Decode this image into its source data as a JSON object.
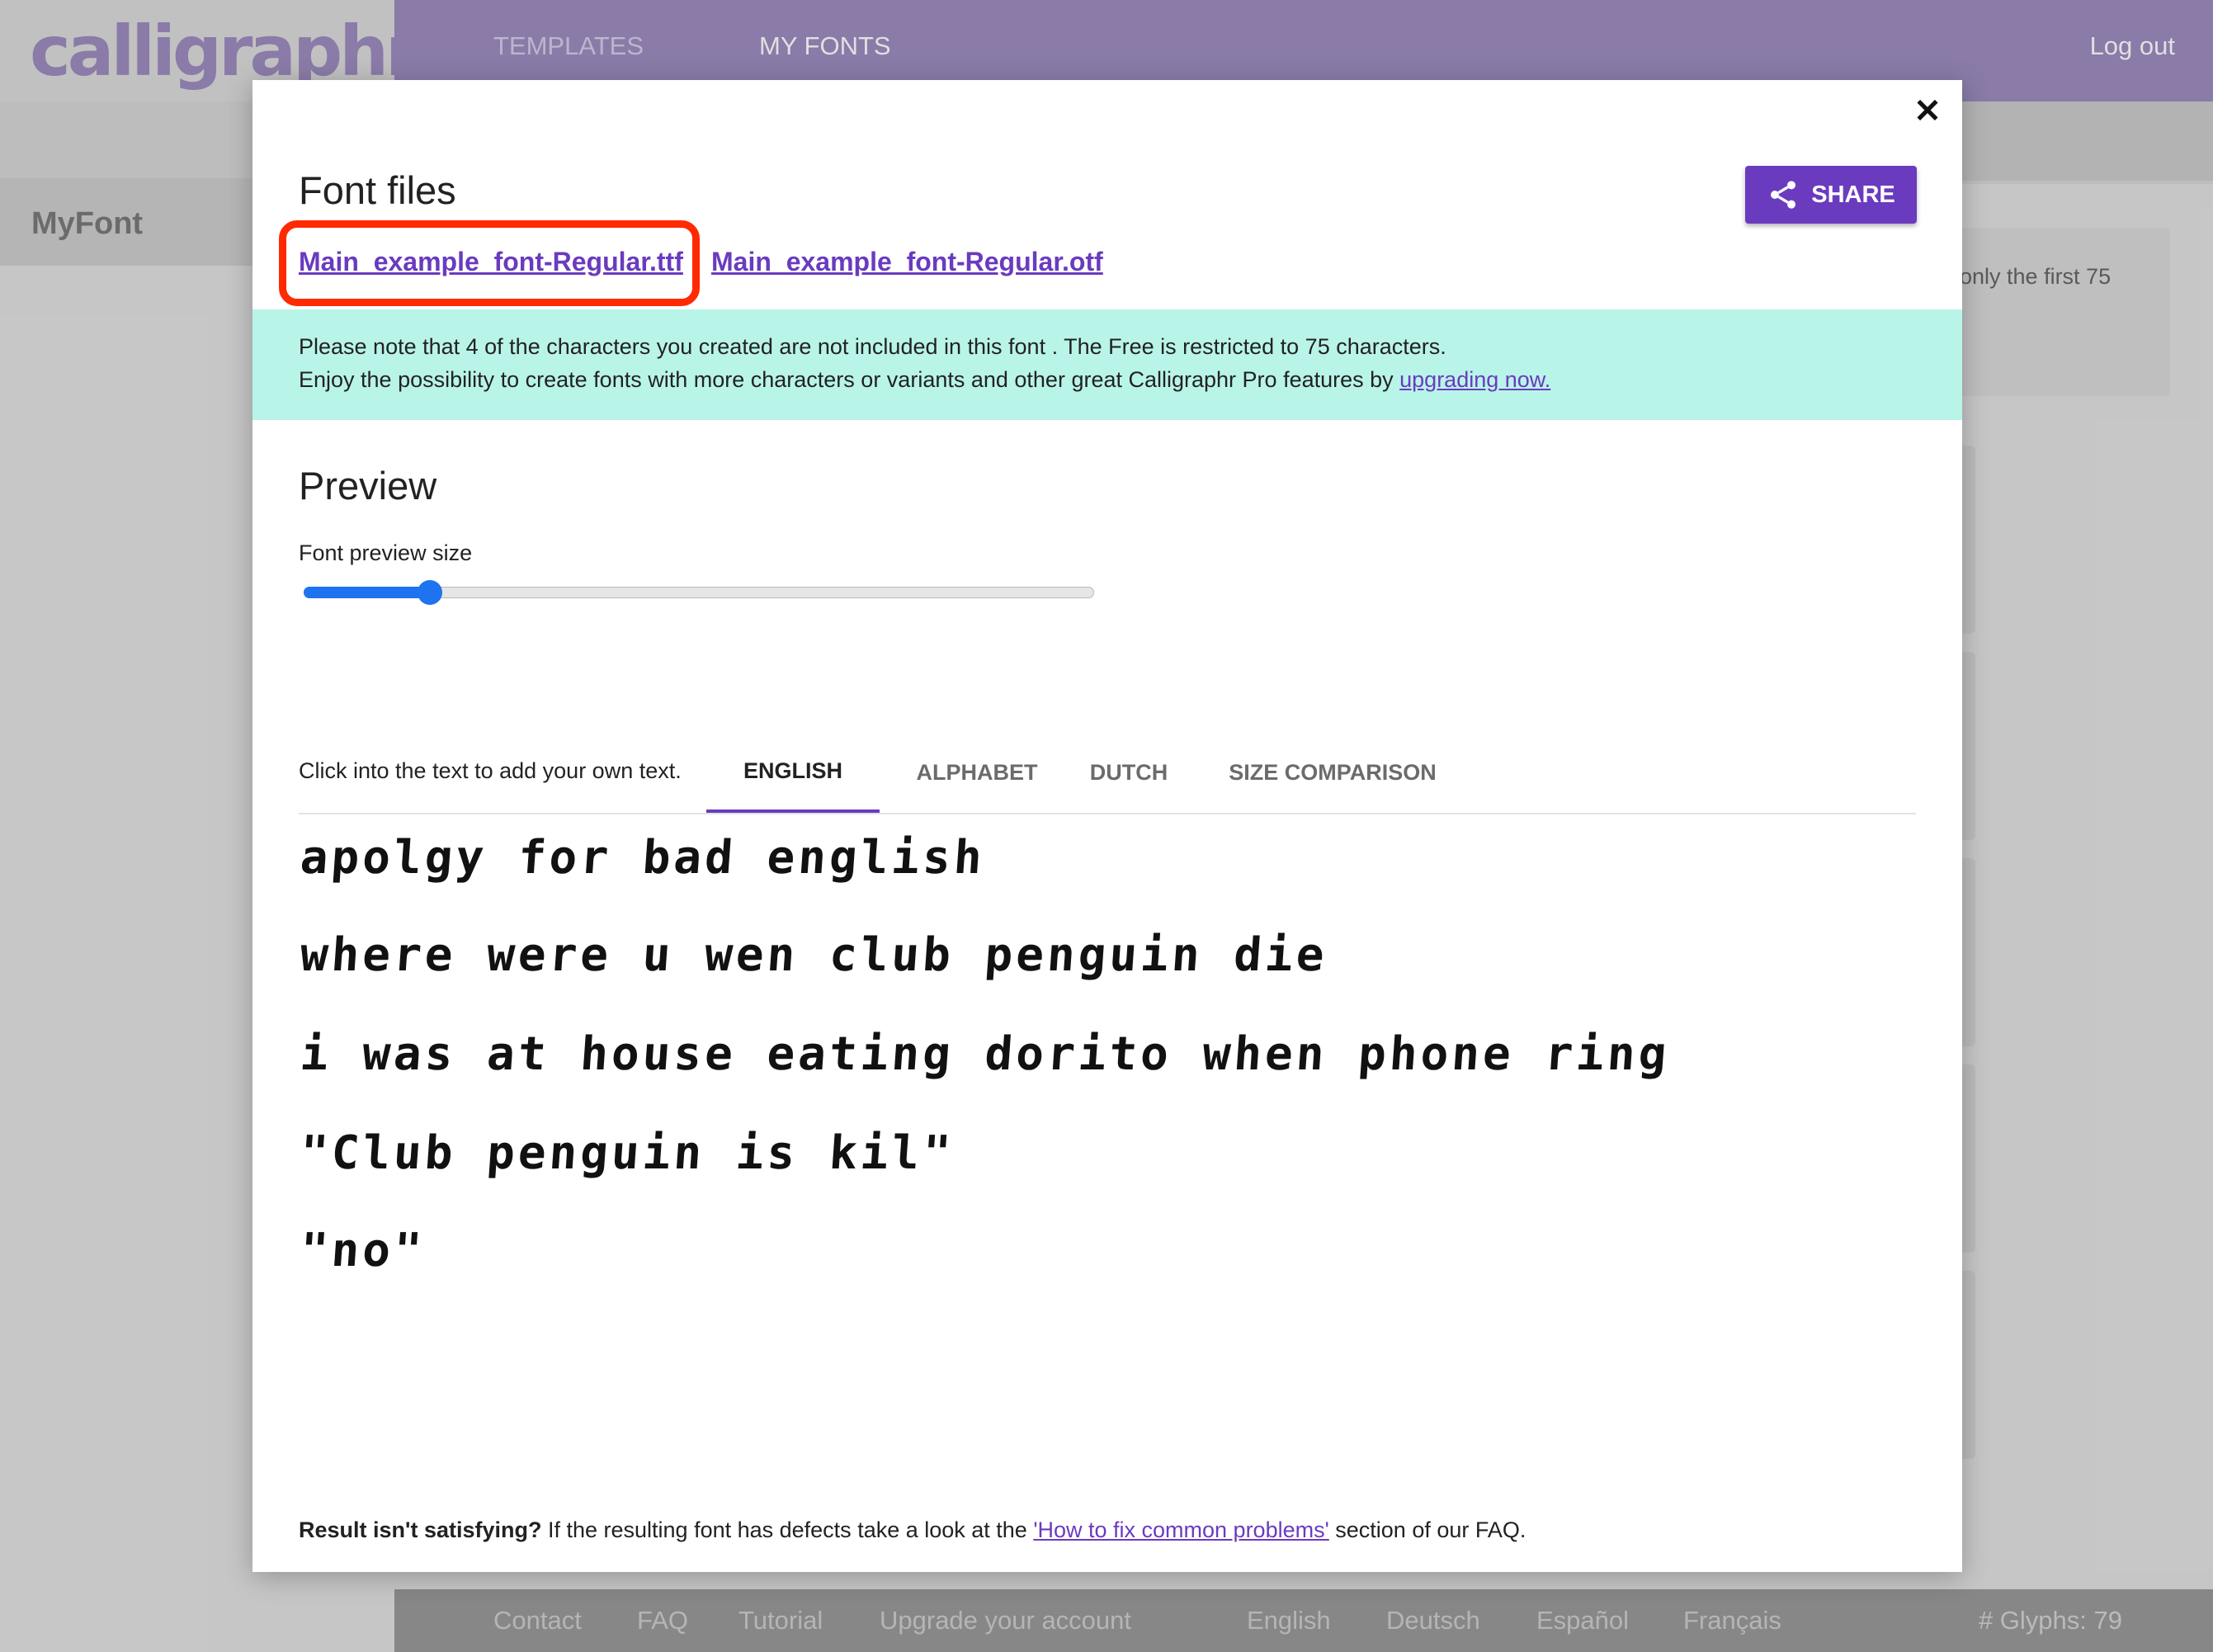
{
  "app": {
    "logo": "calligraphr",
    "nav": [
      "TEMPLATES",
      "MY FONTS"
    ],
    "logout": "Log out",
    "font_name": "MyFont",
    "notice_fragment": "only the first 75"
  },
  "footer": {
    "links": [
      "Contact",
      "FAQ",
      "Tutorial",
      "Upgrade your account",
      "English",
      "Deutsch",
      "Español",
      "Français"
    ],
    "glyphs": "# Glyphs: 79"
  },
  "modal": {
    "close": "✕",
    "font_files_title": "Font files",
    "share_label": "SHARE",
    "file_ttf": "Main_example_font-Regular.ttf",
    "file_otf": "Main_example_font-Regular.otf",
    "info_line1": "Please note that 4 of the characters you created are not included in this font . The Free is restricted to 75 characters.",
    "info_line2_text": "Enjoy the possibility to create fonts with more characters or variants and other great Calligraphr Pro features by ",
    "info_line2_link": "upgrading now.",
    "preview_title": "Preview",
    "size_label": "Font preview size",
    "size_value": 0.16,
    "tabs": [
      "ENGLISH",
      "ALPHABET",
      "DUTCH",
      "SIZE COMPARISON"
    ],
    "active_tab": "ENGLISH",
    "hint": "Click into the text to add your own text.",
    "sample_lines": [
      "apolgy for bad english",
      "where were u wen club penguin die",
      "i was at house eating dorito when phone ring",
      "\"Club penguin is kil\"",
      "\"no\""
    ],
    "result_bold": "Result isn't satisfying?",
    "result_text": " If the resulting font has defects take a look at the ",
    "result_link": "'How to fix common problems'",
    "result_tail": " section of our FAQ."
  },
  "colors": {
    "accent": "#6a3bbf",
    "topbar": "#9e8cc0",
    "info_bg": "#b9f4e9",
    "highlight": "#ff2a00",
    "slider": "#1e73f0"
  }
}
